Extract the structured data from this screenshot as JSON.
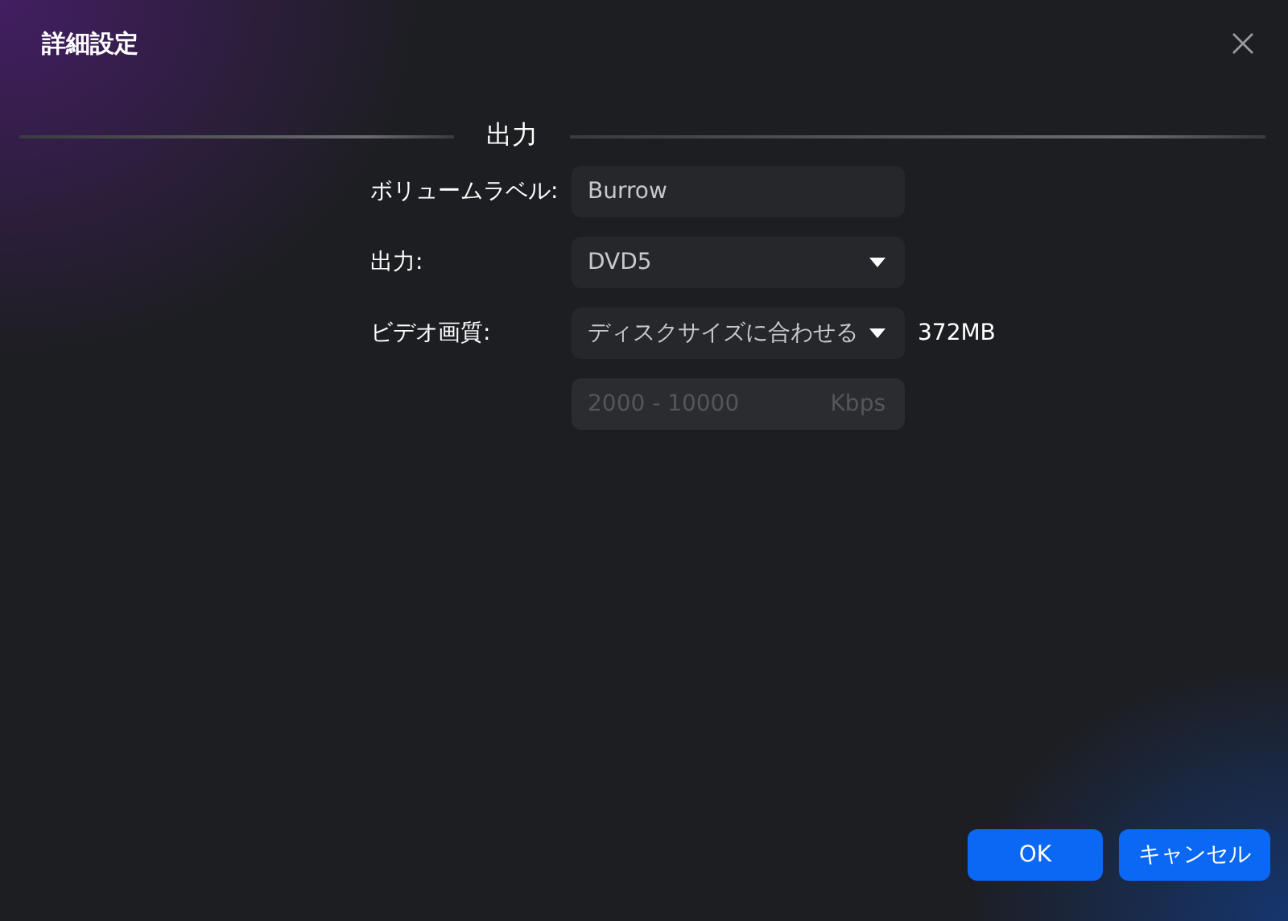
{
  "dialog": {
    "title": "詳細設定"
  },
  "section": {
    "title": "出力"
  },
  "fields": [
    {
      "kind": "text",
      "label": "ボリュームラベル:",
      "value": "Burrow"
    },
    {
      "kind": "select",
      "label": "出力:",
      "value": "DVD5"
    },
    {
      "kind": "select",
      "label": "ビデオ画質:",
      "value": "ディスクサイズに合わせる",
      "note": "372MB"
    },
    {
      "kind": "input",
      "placeholder": "2000 - 10000",
      "unit": "Kbps",
      "disabled": true
    }
  ],
  "buttons": [
    {
      "label": "OK"
    },
    {
      "label": "キャンセル"
    }
  ]
}
